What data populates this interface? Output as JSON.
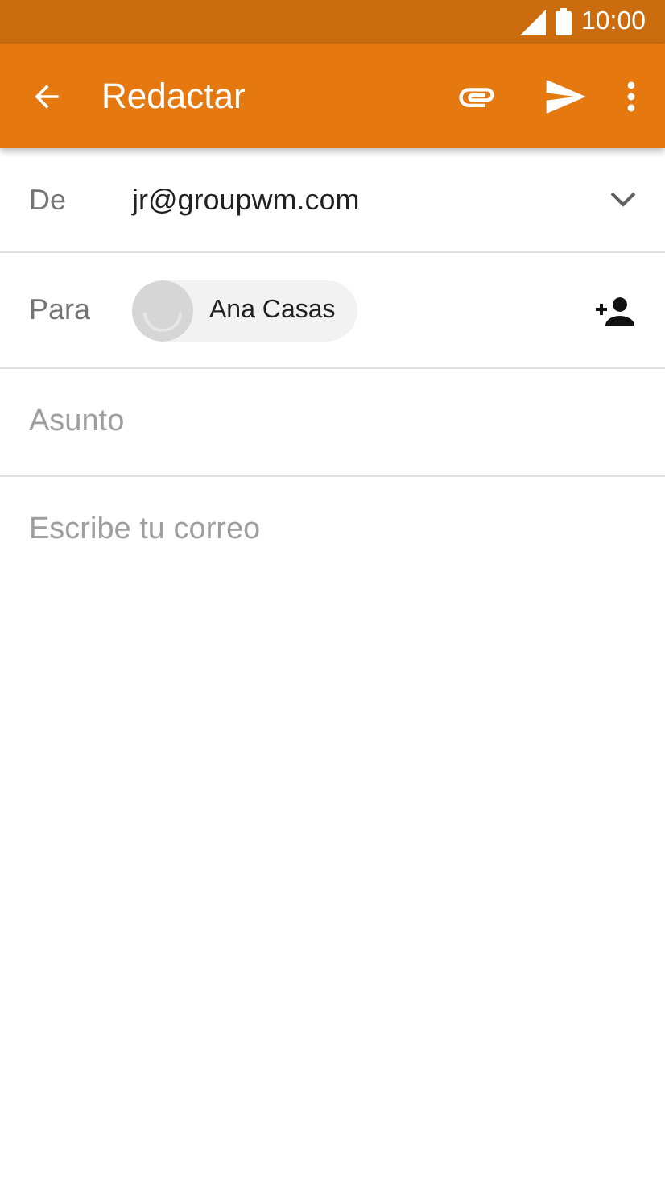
{
  "status_bar": {
    "time": "10:00"
  },
  "app_bar": {
    "title": "Redactar"
  },
  "from": {
    "label": "De",
    "value": "jr@groupwm.com"
  },
  "to": {
    "label": "Para",
    "recipients": [
      {
        "name": "Ana Casas"
      }
    ]
  },
  "subject": {
    "placeholder": "Asunto"
  },
  "body": {
    "placeholder": "Escribe tu correo"
  }
}
